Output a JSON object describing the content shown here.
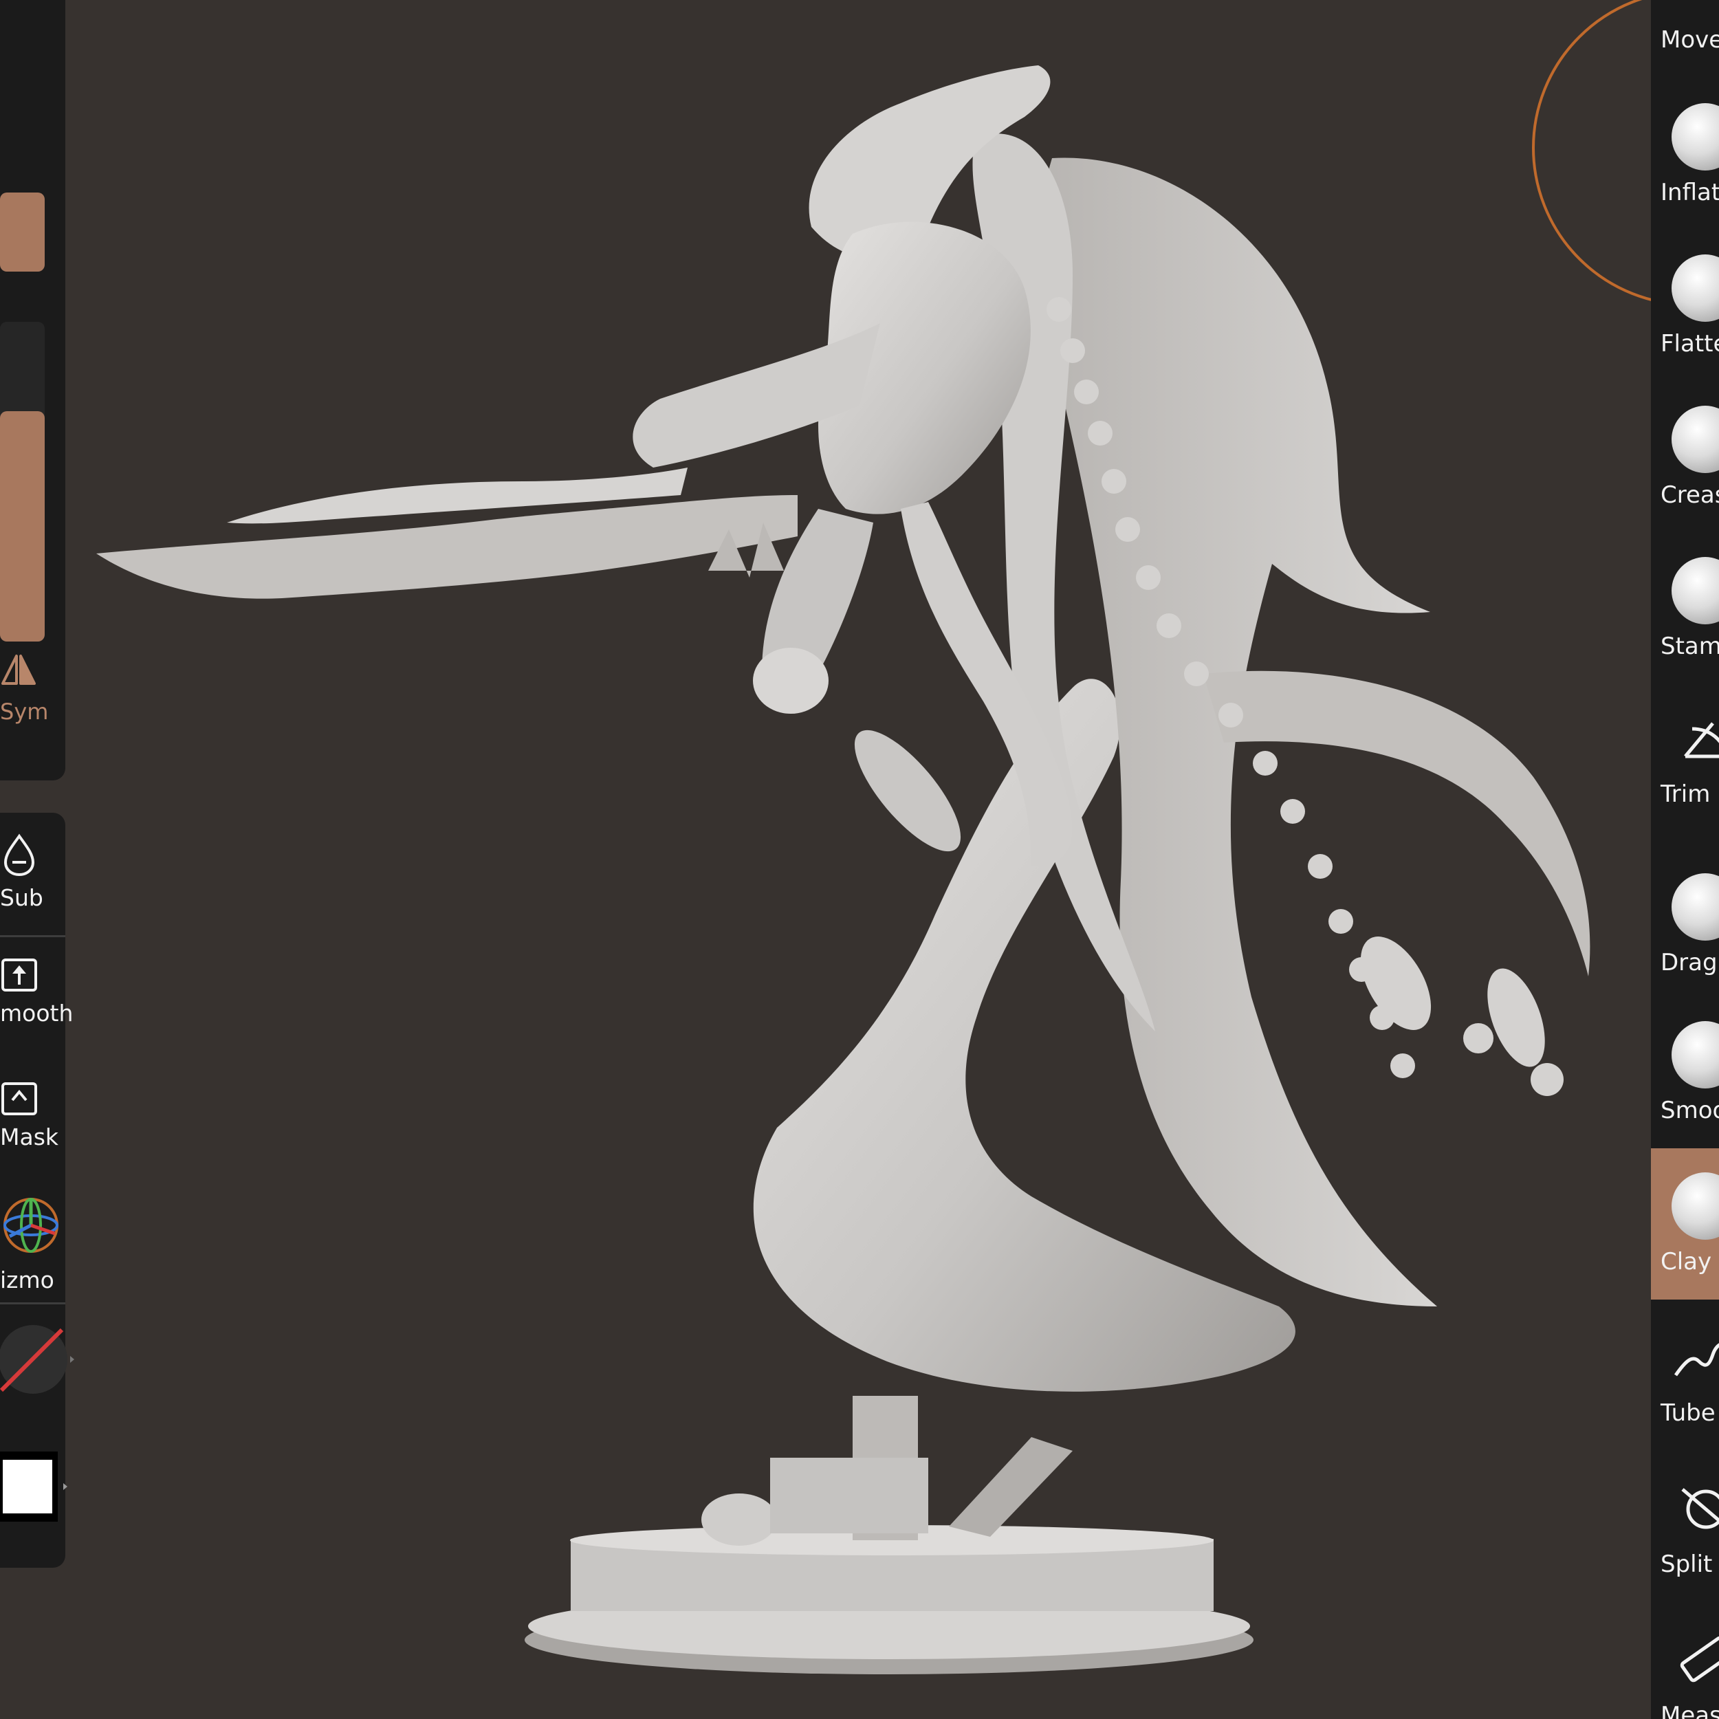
{
  "app": {
    "name": "3D sculpting app",
    "accent_color": "#a8785e",
    "background_color": "#37322f",
    "panel_color": "#1b1b1b"
  },
  "left_toolbar": {
    "sliders": [
      {
        "name": "brush-radius",
        "fill_ratio": 1.0
      },
      {
        "name": "brush-intensity",
        "fill_ratio": 0.72
      }
    ],
    "sym": {
      "label": "Sym",
      "icon": "symmetry-icon",
      "active": true
    }
  },
  "left_tools": [
    {
      "label": "Sub",
      "icon": "drop-minus-icon"
    },
    {
      "label": "mooth",
      "icon": "upload-box-icon"
    },
    {
      "label": "Mask",
      "icon": "caret-box-icon"
    },
    {
      "label": "izmo",
      "icon": "gizmo-icon"
    }
  ],
  "material": {
    "icon": "material-sphere-icon"
  },
  "color_swatch": {
    "icon": "color-swatch-icon",
    "color": "#ffffff"
  },
  "right_brushes": [
    {
      "label": "Move",
      "active": false
    },
    {
      "label": "Inflat",
      "active": false
    },
    {
      "label": "Flatte",
      "active": false
    },
    {
      "label": "Creas",
      "active": false
    },
    {
      "label": "Stam",
      "active": false
    },
    {
      "label": "Trim",
      "active": false
    },
    {
      "label": "Drag",
      "active": false
    },
    {
      "label": "Smoo",
      "active": false
    },
    {
      "label": "Clay",
      "active": true
    },
    {
      "label": "Tube",
      "active": false
    },
    {
      "label": "Split",
      "active": false
    },
    {
      "label": "Measu",
      "active": false
    }
  ],
  "brush_cursor": {
    "color": "#c06a2c"
  },
  "viewport": {
    "subject": "sculpted figure on round base",
    "model_color": "#cfcfcf"
  }
}
